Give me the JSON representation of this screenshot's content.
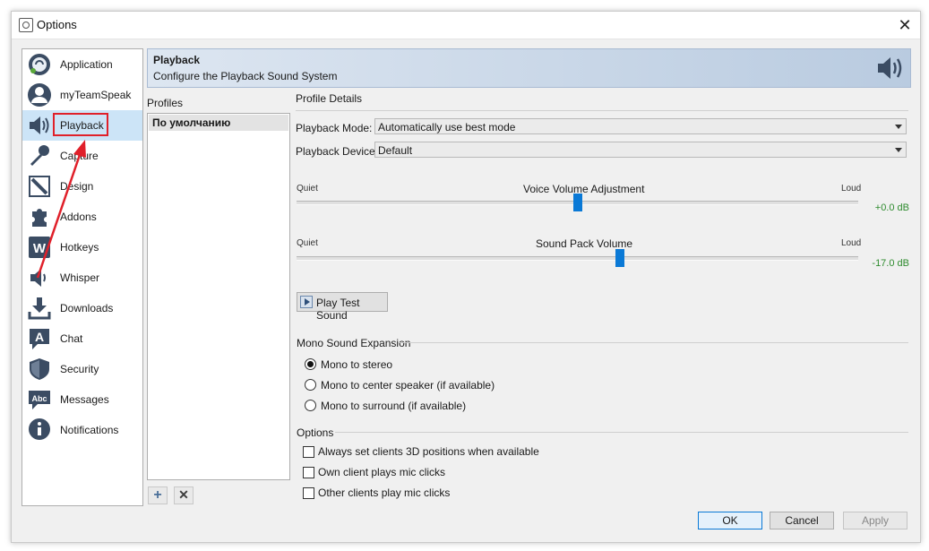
{
  "window": {
    "title": "Options",
    "close_glyph": "✕"
  },
  "nav": {
    "items": [
      {
        "label": "Application",
        "icon": "teamspeak-logo-icon"
      },
      {
        "label": "myTeamSpeak",
        "icon": "user-icon"
      },
      {
        "label": "Playback",
        "icon": "speaker-icon",
        "selected": true
      },
      {
        "label": "Capture",
        "icon": "microphone-icon"
      },
      {
        "label": "Design",
        "icon": "pencil-icon"
      },
      {
        "label": "Addons",
        "icon": "puzzle-icon"
      },
      {
        "label": "Hotkeys",
        "icon": "keyboard-w-icon"
      },
      {
        "label": "Whisper",
        "icon": "whisper-speaker-icon"
      },
      {
        "label": "Downloads",
        "icon": "download-icon"
      },
      {
        "label": "Chat",
        "icon": "chat-a-icon"
      },
      {
        "label": "Security",
        "icon": "shield-icon"
      },
      {
        "label": "Messages",
        "icon": "abc-message-icon"
      },
      {
        "label": "Notifications",
        "icon": "info-icon"
      }
    ]
  },
  "banner": {
    "title": "Playback",
    "subtitle": "Configure the Playback Sound System",
    "icon": "speaker-icon"
  },
  "profiles": {
    "label": "Profiles",
    "items": [
      "По умолчанию"
    ],
    "add_glyph": "+",
    "remove_glyph": "✕"
  },
  "details": {
    "label": "Profile Details",
    "playback_mode_label": "Playback Mode:",
    "playback_mode_value": "Automatically use best mode",
    "playback_device_label": "Playback Device:",
    "playback_device_value": "Default"
  },
  "sliders": {
    "voice": {
      "title": "Voice Volume Adjustment",
      "min_label": "Quiet",
      "max_label": "Loud",
      "value_text": "+0.0 dB",
      "fraction": 0.5
    },
    "soundpack": {
      "title": "Sound Pack Volume",
      "min_label": "Quiet",
      "max_label": "Loud",
      "value_text": "-17.0 dB",
      "fraction": 0.575
    }
  },
  "test_button": {
    "label": "Play Test Sound"
  },
  "mono": {
    "label": "Mono Sound Expansion",
    "options": [
      "Mono to stereo",
      "Mono to center speaker (if available)",
      "Mono to surround (if available)"
    ],
    "selected_index": 0
  },
  "options": {
    "label": "Options",
    "items": [
      "Always set clients 3D positions when available",
      "Own client plays mic clicks",
      "Other clients play mic clicks"
    ]
  },
  "footer": {
    "ok": "OK",
    "cancel": "Cancel",
    "apply": "Apply"
  },
  "colors": {
    "selection": "#cce4f7",
    "accent": "#0a79d6",
    "annotation": "#e0202a",
    "db_green": "#2e8b2e"
  }
}
